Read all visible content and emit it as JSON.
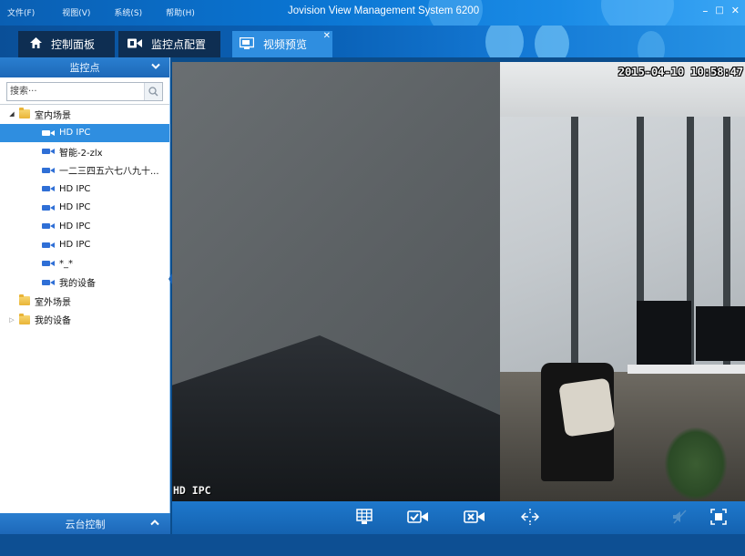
{
  "menu": {
    "file": "文件(F)",
    "view": "视图(V)",
    "system": "系统(S)",
    "help": "帮助(H)"
  },
  "app_title": "Jovision View Management System 6200",
  "window_controls": {
    "minimize": "–",
    "maximize": "□",
    "close": "✕"
  },
  "tabs": [
    {
      "label": "控制面板",
      "icon": "home-icon"
    },
    {
      "label": "监控点配置",
      "icon": "camera-config-icon"
    },
    {
      "label": "视频预览",
      "icon": "monitor-preview-icon",
      "active": true,
      "close": "✕"
    }
  ],
  "sidebar": {
    "header": "监控点",
    "search_placeholder": "搜索···",
    "tree": {
      "indoor": {
        "label": "室内场景",
        "expanded": true
      },
      "devices": [
        {
          "label": "HD IPC",
          "selected": true
        },
        {
          "label": "智能-2-zlx"
        },
        {
          "label": "一二三四五六七八九十..."
        },
        {
          "label": "HD IPC"
        },
        {
          "label": "HD IPC"
        },
        {
          "label": "HD IPC"
        },
        {
          "label": "HD IPC"
        },
        {
          "label": "*_*"
        },
        {
          "label": "我的设备"
        }
      ],
      "outdoor": {
        "label": "室外场景"
      },
      "my_devices": {
        "label": "我的设备",
        "expanded": false
      }
    },
    "ptz_label": "云台控制"
  },
  "video": {
    "timestamp": "2015-04-10 10:58:47",
    "channel_name": "HD IPC"
  },
  "toolbar": {
    "buttons": [
      "layout-grid-icon",
      "camera-check-icon",
      "camera-close-icon",
      "split-icon",
      "mute-icon",
      "fullscreen-icon"
    ]
  },
  "colors": {
    "accent": "#2f8ee0",
    "titlebar": "#0a74d1",
    "sidebar_header": "#2a7fd0"
  }
}
